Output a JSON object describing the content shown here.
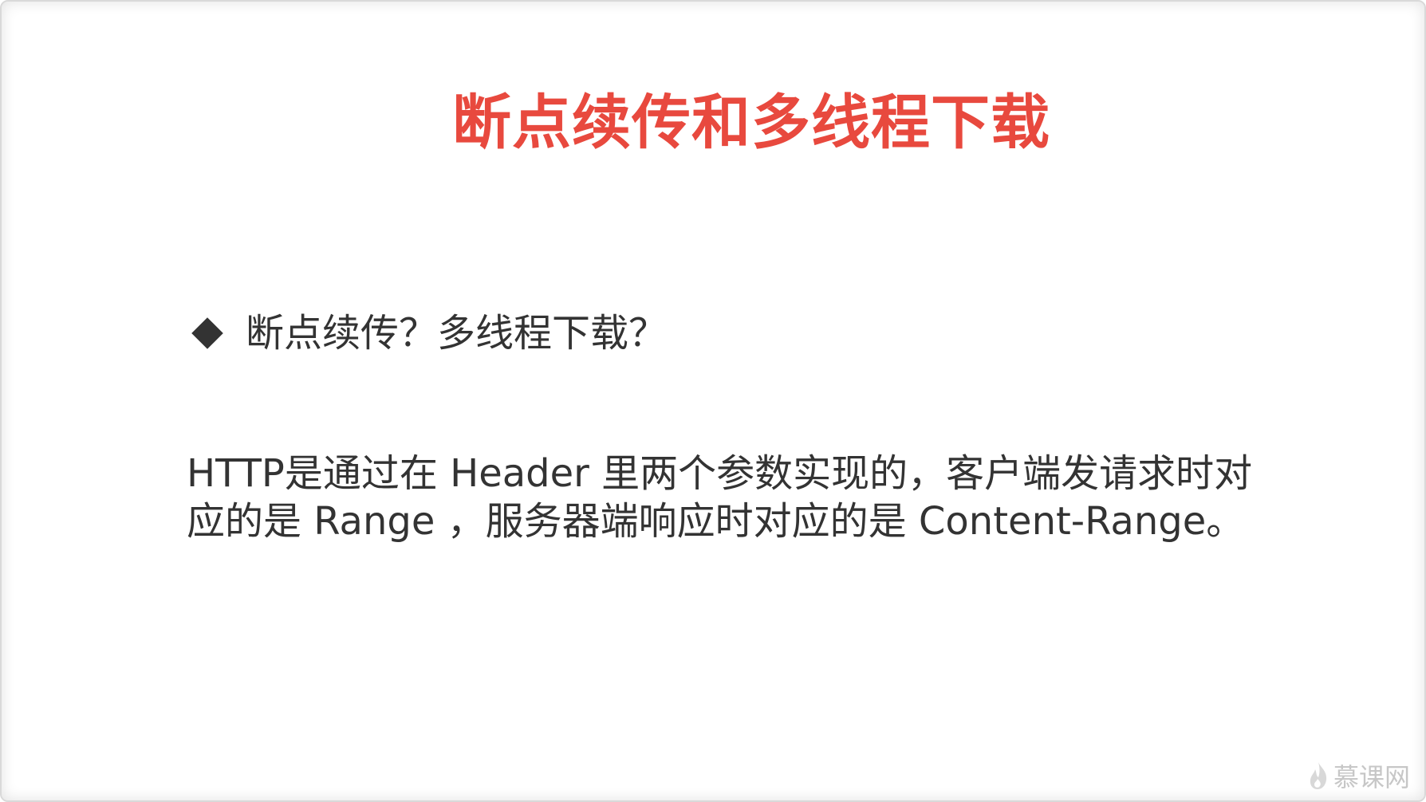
{
  "slide": {
    "title": "断点续传和多线程下载",
    "bullet": "断点续传？多线程下载？",
    "body_lines": [
      "HTTP是通过在 Header 里两个参数实现的，客户端发请求时对",
      "应的是 Range ，服务器端响应时对应的是 Content-Range。"
    ],
    "watermark": "慕课网"
  },
  "colors": {
    "title": "#e8493e",
    "text": "#333333",
    "watermark": "#c7c7c7"
  },
  "icons": {
    "bullet": "diamond-bullet-icon",
    "watermark": "flame-logo-icon"
  }
}
